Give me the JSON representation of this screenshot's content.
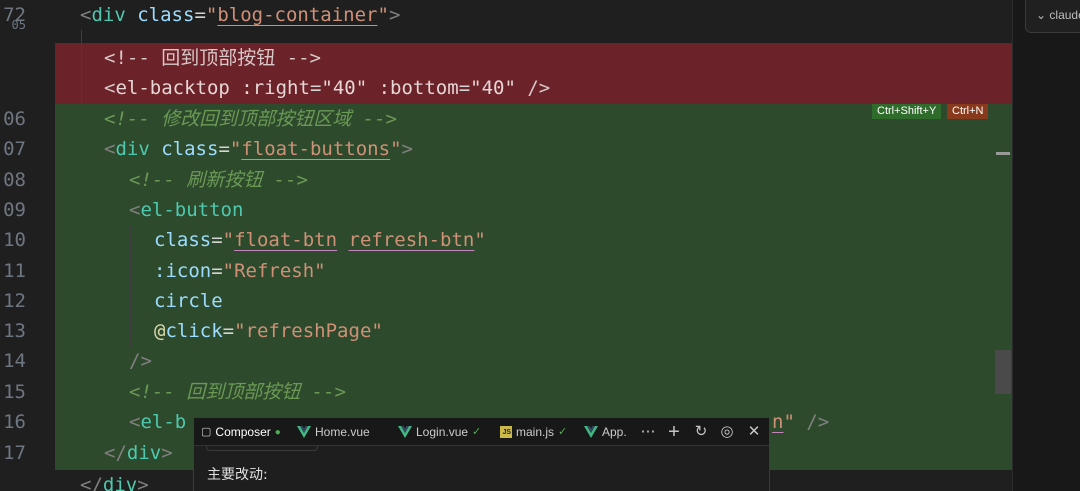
{
  "editor": {
    "line_numbers": [
      "72",
      "05",
      "",
      "",
      "06",
      "07",
      "08",
      "09",
      "10",
      "11",
      "12",
      "13",
      "14",
      "15",
      "16",
      "17",
      ""
    ],
    "lines": {
      "l72": {
        "open": "<",
        "tag": "div",
        "attr": "class",
        "eq": "=",
        "q1": "\"",
        "val": "blog-container",
        "q2": "\"",
        "close": ">"
      },
      "del1": {
        "text": "<!-- 回到顶部按钮 -->"
      },
      "del2": {
        "open": "<",
        "tag": "el-backtop",
        "a1": ":right",
        "v1": "\"40\"",
        "a2": ":bottom",
        "v2": "\"40\"",
        "close": "/>"
      },
      "l06": {
        "text": "<!-- 修改回到顶部按钮区域 -->"
      },
      "l07": {
        "open": "<",
        "tag": "div",
        "attr": "class",
        "eq": "=",
        "q1": "\"",
        "val": "float-buttons",
        "q2": "\"",
        "close": ">"
      },
      "l08": {
        "text": "<!-- 刷新按钮 -->"
      },
      "l09": {
        "open": "<",
        "tag": "el-button"
      },
      "l10": {
        "attr": "class",
        "eq": "=",
        "q1": "\"",
        "v1": "float-btn",
        "sp": " ",
        "v2": "refresh-btn",
        "q2": "\""
      },
      "l11": {
        "attr": ":icon",
        "eq": "=",
        "val": "\"Refresh\""
      },
      "l12": {
        "text": "circle"
      },
      "l13": {
        "at": "@",
        "attr": "click",
        "eq": "=",
        "val": "\"refreshPage\""
      },
      "l14": {
        "text": "/>"
      },
      "l15": {
        "text": "<!-- 回到顶部按钮 -->"
      },
      "l16": {
        "open": "<",
        "tag": "el-b",
        "tail_q": "\"",
        "tail_close": " />",
        "tail_str": "n"
      },
      "l17": {
        "open": "</",
        "tag": "div",
        "close": ">"
      },
      "l18": {
        "open": "</",
        "tag": "div",
        "close": ">"
      }
    },
    "accept_shortcut": "Ctrl+Shift+Y",
    "reject_shortcut": "Ctrl+N"
  },
  "right_panel": {
    "label": "claude"
  },
  "composer": {
    "tabs": [
      {
        "label": "Composer",
        "icon": "composer-icon"
      },
      {
        "label": "Home.vue",
        "icon": "vue-icon"
      },
      {
        "label": "Login.vue",
        "icon": "vue-icon"
      },
      {
        "label": "main.js",
        "icon": "js-icon"
      },
      {
        "label": "App.",
        "icon": "vue-icon"
      }
    ],
    "body_text": "主要改动:"
  },
  "colors": {
    "deleted_bg": "#6b2228",
    "added_bg": "#2e4a2c",
    "accent_green": "#4caf50"
  }
}
